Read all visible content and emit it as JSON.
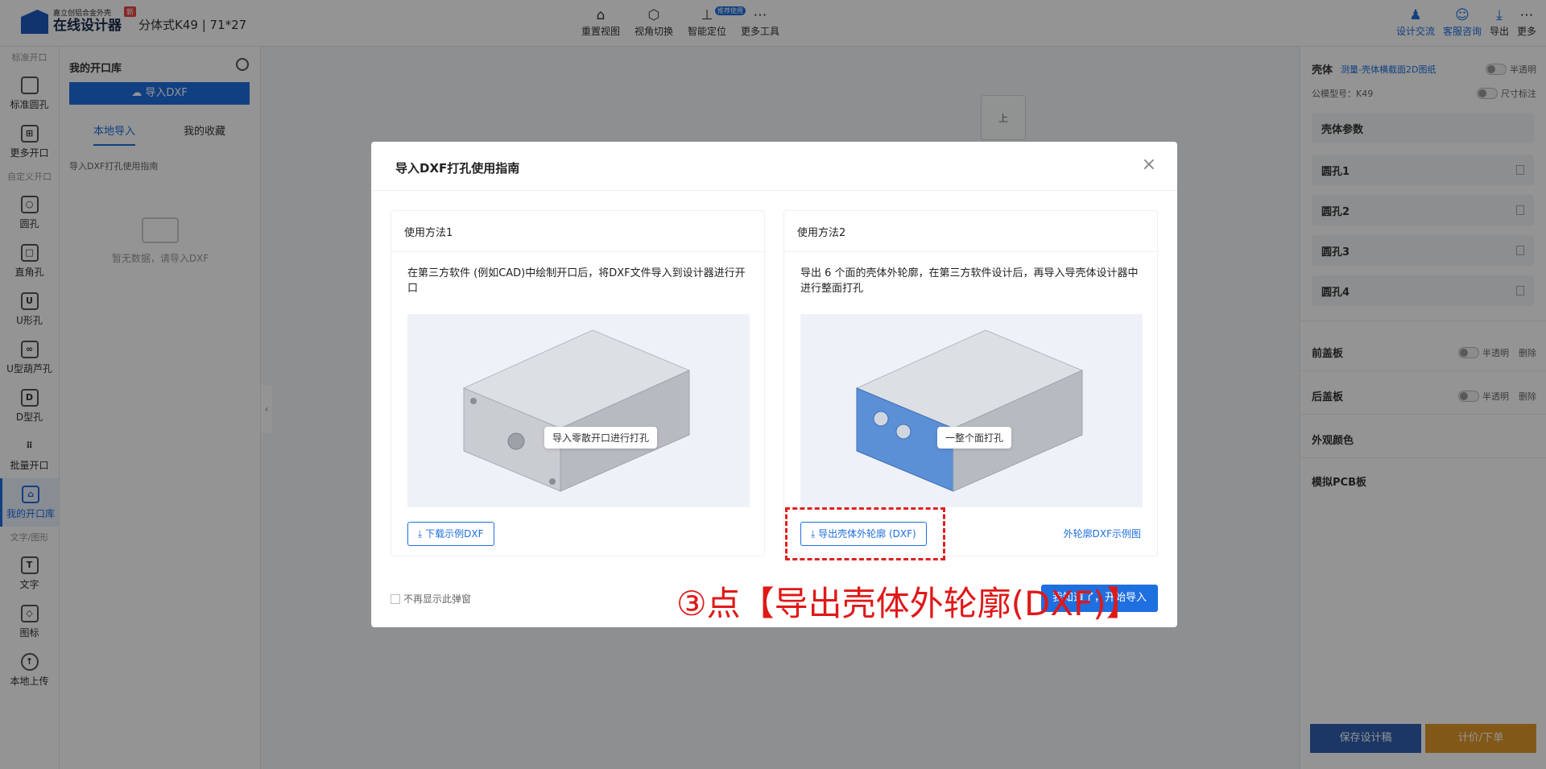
{
  "app": {
    "logo_sub": "嘉立创铝合金外壳",
    "logo_main": "在线设计器",
    "new_badge": "新",
    "model_name": "分体式K49 | 71*27"
  },
  "toolbar": {
    "items": [
      {
        "label": "重置视图",
        "icon": "home-icon"
      },
      {
        "label": "视角切换",
        "icon": "view-cube-icon"
      },
      {
        "label": "智能定位",
        "icon": "locate-icon",
        "badge": "推荐使用"
      },
      {
        "label": "更多工具",
        "icon": "more-icon"
      }
    ],
    "right": [
      {
        "label": "设计交流",
        "icon": "community-icon"
      },
      {
        "label": "客服咨询",
        "icon": "support-icon"
      },
      {
        "label": "导出",
        "icon": "download-icon"
      },
      {
        "label": "更多",
        "icon": "more-icon"
      }
    ]
  },
  "rail": {
    "sections": {
      "standard": "标准开口",
      "custom": "自定义开口",
      "text": "文字/图形"
    },
    "items": [
      {
        "label": "标准圆孔"
      },
      {
        "label": "更多开口"
      },
      {
        "label": "圆孔"
      },
      {
        "label": "直角孔"
      },
      {
        "label": "U形孔"
      },
      {
        "label": "U型葫芦孔"
      },
      {
        "label": "D型孔"
      },
      {
        "label": "批量开口"
      },
      {
        "label": "我的开口库"
      },
      {
        "label": "文字"
      },
      {
        "label": "图标"
      },
      {
        "label": "本地上传"
      }
    ]
  },
  "library": {
    "title": "我的开口库",
    "import_button": "导入DXF",
    "tabs": [
      "本地导入",
      "我的收藏"
    ],
    "guide": "导入DXF打孔使用指南",
    "empty": "暂无数据，请导入DXF"
  },
  "canvas": {
    "view_cube_label": "上"
  },
  "props": {
    "shell_title": "壳体",
    "measure_link": "测量-壳体横截面2D图纸",
    "translucent": "半透明",
    "model_label": "公模型号：K49",
    "dimension_label": "尺寸标注",
    "shell_params": "壳体参数",
    "holes": [
      "圆孔1",
      "圆孔2",
      "圆孔3",
      "圆孔4"
    ],
    "front_panel": "前盖板",
    "back_panel": "后盖板",
    "delete": "删除",
    "appearance": "外观颜色",
    "pcb": "模拟PCB板",
    "save_button": "保存设计稿",
    "price_button": "计价/下单"
  },
  "modal": {
    "title": "导入DXF打孔使用指南",
    "method1": {
      "title": "使用方法1",
      "desc": "在第三方软件 (例如CAD)中绘制开口后，将DXF文件导入到设计器进行开口",
      "tip": "导入零散开口进行打孔",
      "button": "下载示例DXF"
    },
    "method2": {
      "title": "使用方法2",
      "desc": "导出 6 个面的壳体外轮廓，在第三方软件设计后，再导入导壳体设计器中进行整面打孔",
      "tip": "一整个面打孔",
      "button": "导出壳体外轮廓 (DXF)",
      "link": "外轮廓DXF示例图"
    },
    "checkbox_label": "不再显示此弹窗",
    "ok_button": "我知道了，开始导入"
  },
  "annotation": "③点【导出壳体外轮廓(DXF)】",
  "colors": {
    "primary": "#1e6fe0",
    "annotation_red": "#e01818",
    "price_orange": "#e0982b",
    "highlight_face": "#5b8fd6"
  }
}
